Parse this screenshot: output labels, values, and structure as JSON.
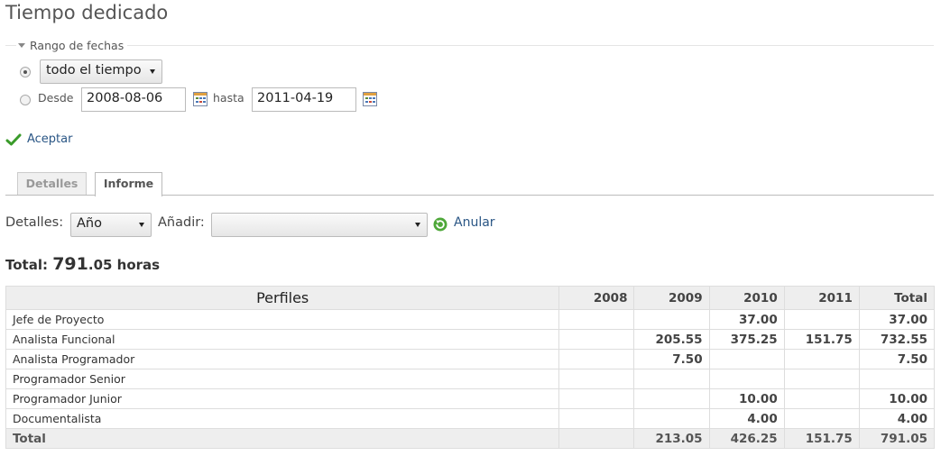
{
  "page": {
    "title": "Tiempo dedicado"
  },
  "filters": {
    "legend": "Rango de fechas",
    "period_select": "todo el tiempo",
    "from_label": "Desde",
    "from_value": "2008-08-06",
    "to_label": "hasta",
    "to_value": "2011-04-19",
    "accept_label": "Aceptar"
  },
  "tabs": [
    {
      "label": "Detalles"
    },
    {
      "label": "Informe"
    }
  ],
  "report_controls": {
    "details_label": "Detalles:",
    "details_value": "Año",
    "add_label": "Añadir:",
    "add_value": "",
    "cancel_label": "Anular"
  },
  "summary": {
    "prefix": "Total: ",
    "whole": "791",
    "rest": ".05 horas"
  },
  "table": {
    "headers": [
      "Perfiles",
      "2008",
      "2009",
      "2010",
      "2011",
      "Total"
    ],
    "rows": [
      [
        "Jefe de Proyecto",
        "",
        "",
        "37.00",
        "",
        "37.00"
      ],
      [
        "Analista Funcional",
        "",
        "205.55",
        "375.25",
        "151.75",
        "732.55"
      ],
      [
        "Analista Programador",
        "",
        "7.50",
        "",
        "",
        "7.50"
      ],
      [
        "Programador Senior",
        "",
        "",
        "",
        "",
        ""
      ],
      [
        "Programador Junior",
        "",
        "",
        "10.00",
        "",
        "10.00"
      ],
      [
        "Documentalista",
        "",
        "",
        "4.00",
        "",
        "4.00"
      ]
    ],
    "total": [
      "Total",
      "",
      "213.05",
      "426.25",
      "151.75",
      "791.05"
    ]
  },
  "colors": {
    "link": "#2a5685",
    "check_green": "#3a9b2a",
    "header_bg": "#eeeeee"
  },
  "icons": {
    "legend": "triangle-down-icon",
    "calendar": "calendar-icon",
    "accept": "checkmark-icon",
    "cancel": "reload-icon"
  }
}
